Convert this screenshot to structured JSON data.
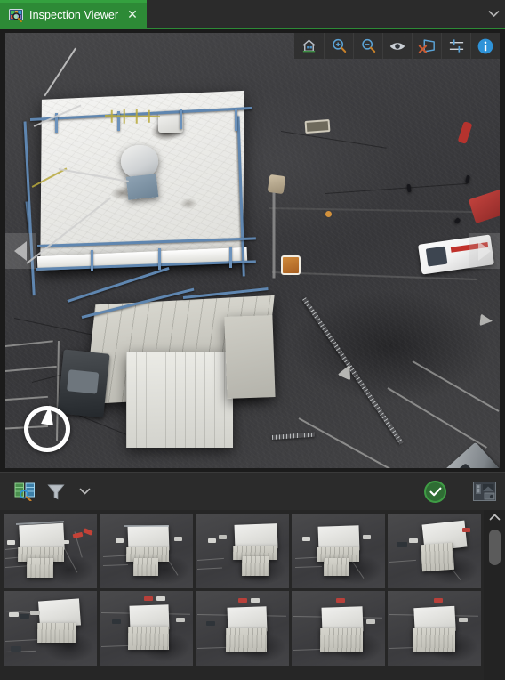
{
  "window": {
    "title": "Inspection Viewer"
  },
  "tabbar": {
    "tabs": [
      {
        "label": "Inspection Viewer",
        "icon": "inspection-image-icon",
        "close_label": "✕",
        "active": true
      }
    ],
    "overflow_icon": "chevron-down-icon"
  },
  "viewer_toolbar": {
    "buttons": [
      {
        "name": "home-icon",
        "title": "Home / Fit view"
      },
      {
        "name": "zoom-in-icon",
        "title": "Zoom in"
      },
      {
        "name": "zoom-out-icon",
        "title": "Zoom out"
      },
      {
        "name": "eye-icon",
        "title": "Show / hide overlays"
      },
      {
        "name": "clear-shape-icon",
        "title": "Clear annotation"
      },
      {
        "name": "sliders-icon",
        "title": "Image adjustments"
      },
      {
        "name": "info-icon",
        "title": "Image information"
      }
    ]
  },
  "viewer": {
    "prev_label": "◀",
    "next_label": "▶",
    "compass_name": "north-compass-indicator",
    "scene": {
      "subject": "aerial rooftop inspection photo",
      "notes": "white flat roof with blue safety railing, antenna mast, radome, parking lot"
    }
  },
  "bottom_toolbar": {
    "inspection_icon": "inspection-grid-icon",
    "filter_icon": "filter-funnel-icon",
    "filter_chevron": "chevron-down-icon",
    "approve_icon": "check-circle-icon",
    "approve_mark": "✓",
    "layout_icon": "panel-layout-icon"
  },
  "thumbnails": {
    "scroll_up_icon": "chevron-up-icon",
    "selected_index": 0,
    "items": [
      {
        "name": "thumbnail-1",
        "selected": true,
        "variant": "a"
      },
      {
        "name": "thumbnail-2",
        "selected": false,
        "variant": "b"
      },
      {
        "name": "thumbnail-3",
        "selected": false,
        "variant": "c"
      },
      {
        "name": "thumbnail-4",
        "selected": false,
        "variant": "b"
      },
      {
        "name": "thumbnail-5",
        "selected": false,
        "variant": "d"
      },
      {
        "name": "thumbnail-6",
        "selected": false,
        "variant": "e"
      },
      {
        "name": "thumbnail-7",
        "selected": false,
        "variant": "f"
      },
      {
        "name": "thumbnail-8",
        "selected": false,
        "variant": "g"
      },
      {
        "name": "thumbnail-9",
        "selected": false,
        "variant": "g"
      },
      {
        "name": "thumbnail-10",
        "selected": false,
        "variant": "g"
      }
    ]
  },
  "colors": {
    "tab_green": "#2d8a36",
    "tab_green_accent": "#34a13f",
    "selection_yellow": "#f5e315",
    "approve_green": "#3f9c45",
    "accent_blue": "#3a9fd8",
    "chrome_dark": "#2b2b2b",
    "panel_dark": "#262626"
  }
}
